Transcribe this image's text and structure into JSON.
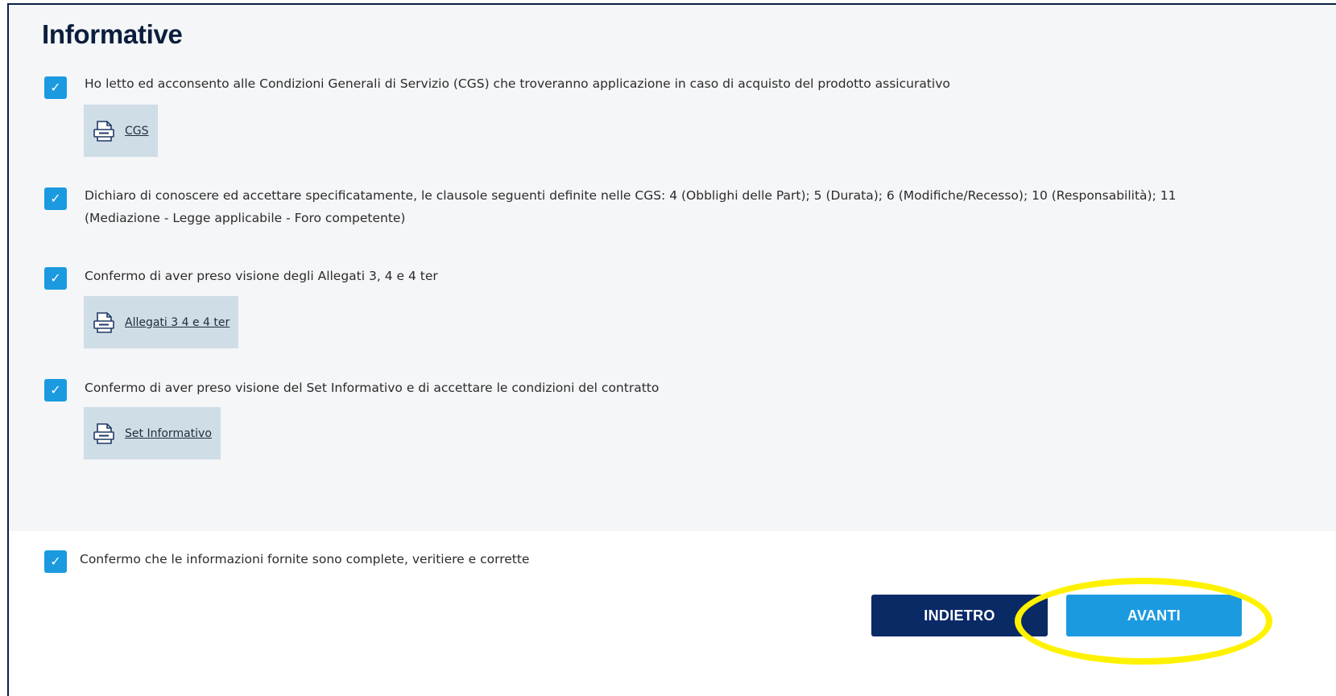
{
  "section": {
    "title": "Informative"
  },
  "items": [
    {
      "checked": true,
      "text": "Ho letto ed acconsento alle Condizioni Generali di Servizio (CGS) che troveranno applicazione in caso di acquisto del prodotto assicurativo",
      "document": {
        "label": "CGS",
        "icon": "pdf-icon"
      }
    },
    {
      "checked": true,
      "text_line1": "Dichiaro di conoscere ed accettare specificatamente, le clausole seguenti definite nelle CGS: 4 (Obblighi delle Part); 5 (Durata); 6 (Modifiche/Recesso); 10 (Responsabilità); 11",
      "text_line2": "(Mediazione - Legge applicabile - Foro competente)"
    },
    {
      "checked": true,
      "text": "Confermo di aver preso visione degli Allegati 3, 4 e 4 ter",
      "document": {
        "label": "Allegati 3 4 e 4 ter",
        "icon": "pdf-icon"
      }
    },
    {
      "checked": true,
      "text": "Confermo di aver preso visione del Set Informativo e di accettare le condizioni del contratto",
      "document": {
        "label": "Set Informativo",
        "icon": "pdf-icon"
      }
    }
  ],
  "final_confirmation": {
    "checked": true,
    "text": "Confermo che le informazioni fornite sono complete, veritiere e corrette"
  },
  "checkmark_glyph": "✓",
  "buttons": {
    "back_label": "INDIETRO",
    "next_label": "AVANTI"
  },
  "colors": {
    "checkbox": "#1b9ae0",
    "back_button": "#0a2a66",
    "next_button": "#1b9ae0",
    "document_chip": "#cfdde7",
    "highlight": "#fff200"
  }
}
